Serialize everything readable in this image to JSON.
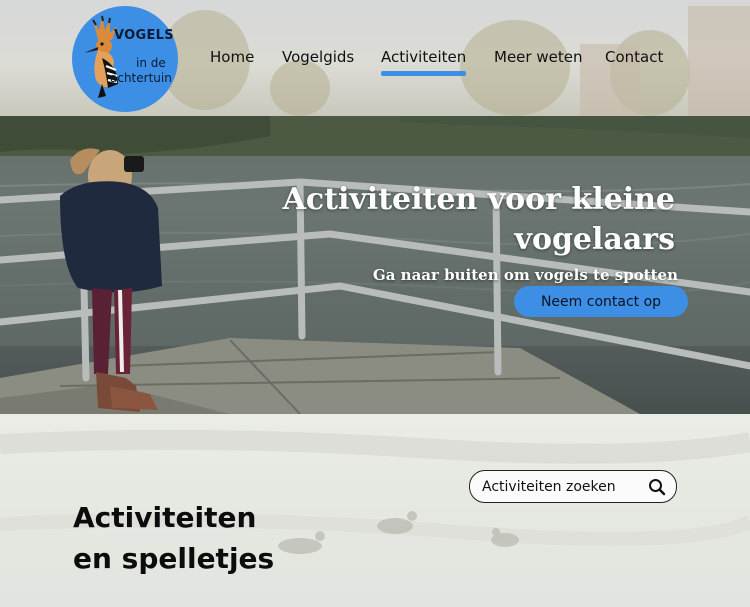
{
  "logo": {
    "title": "VOGELS",
    "subtitle_line1": "in de",
    "subtitle_line2": "achtertuin",
    "icon": "hoopoe-bird-icon"
  },
  "nav": {
    "items": [
      {
        "label": "Home",
        "active": false
      },
      {
        "label": "Vogelgids",
        "active": false
      },
      {
        "label": "Activiteiten",
        "active": true
      },
      {
        "label": "Meer weten",
        "active": false
      },
      {
        "label": "Contact",
        "active": false
      }
    ]
  },
  "hero": {
    "title": "Activiteiten voor kleine vogelaars",
    "subtitle": "Ga naar buiten om vogels te spotten",
    "cta_label": "Neem contact op",
    "image": "girl-photographing-birds-on-pier"
  },
  "section": {
    "title_line1": "Activiteiten",
    "title_line2": "en spelletjes"
  },
  "search": {
    "placeholder": "Activiteiten zoeken",
    "icon": "search-icon"
  },
  "colors": {
    "accent": "#3d8fe6",
    "text_dark": "#0c1b33",
    "header_bg": "#d8d8d2"
  }
}
